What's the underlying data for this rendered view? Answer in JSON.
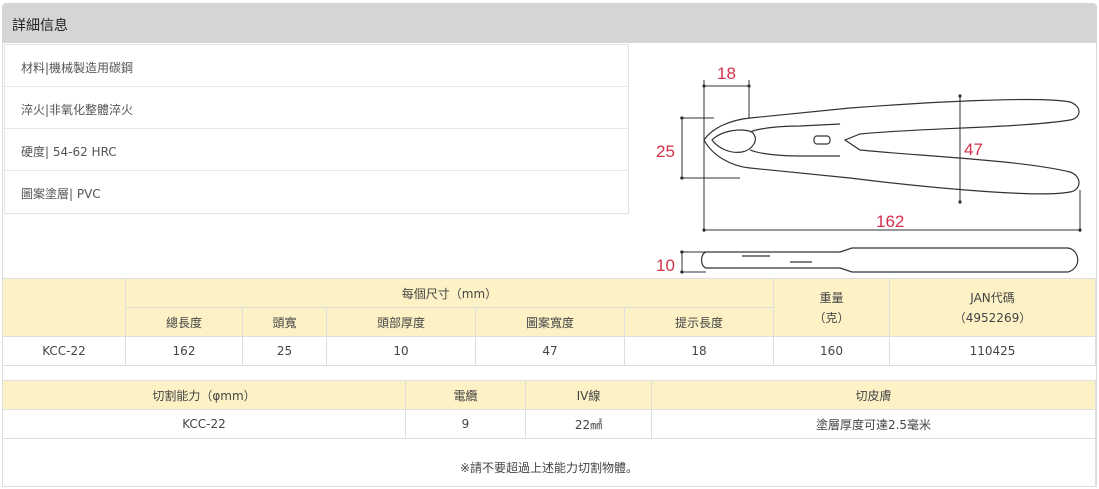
{
  "header": {
    "title": "詳細信息"
  },
  "specs": [
    {
      "text": "材料|機械製造用碳鋼"
    },
    {
      "text": "淬火|非氧化整體淬火"
    },
    {
      "text": "硬度| 54-62 HRC"
    },
    {
      "text": "圖案塗層| PVC"
    }
  ],
  "diagram": {
    "jaw_label": "18",
    "head_label": "25",
    "width_label": "47",
    "length_label": "162",
    "thickness_label": "10"
  },
  "dim_table": {
    "group_header": "每個尺寸（mm）",
    "weight_header": "重量\n（克）",
    "jan_header": "JAN代碼\n（4952269）",
    "sub_headers": [
      "總長度",
      "頭寬",
      "頭部厚度",
      "圖案寬度",
      "提示長度"
    ],
    "row": {
      "model": "KCC-22",
      "values": [
        "162",
        "25",
        "10",
        "47",
        "18",
        "160",
        "110425"
      ]
    }
  },
  "cut_table": {
    "headers": [
      "切割能力（φmm）",
      "電纜",
      "IV線",
      "切皮膚"
    ],
    "row": [
      "KCC-22",
      "9",
      "22㎟",
      "塗層厚度可達2.5毫米"
    ]
  },
  "note": {
    "text": "※請不要超過上述能力切割物體。"
  },
  "colors": {
    "dimension": "#d3314b",
    "header_bg": "#d5d5d5",
    "table_header_bg": "#fdf1c6"
  }
}
